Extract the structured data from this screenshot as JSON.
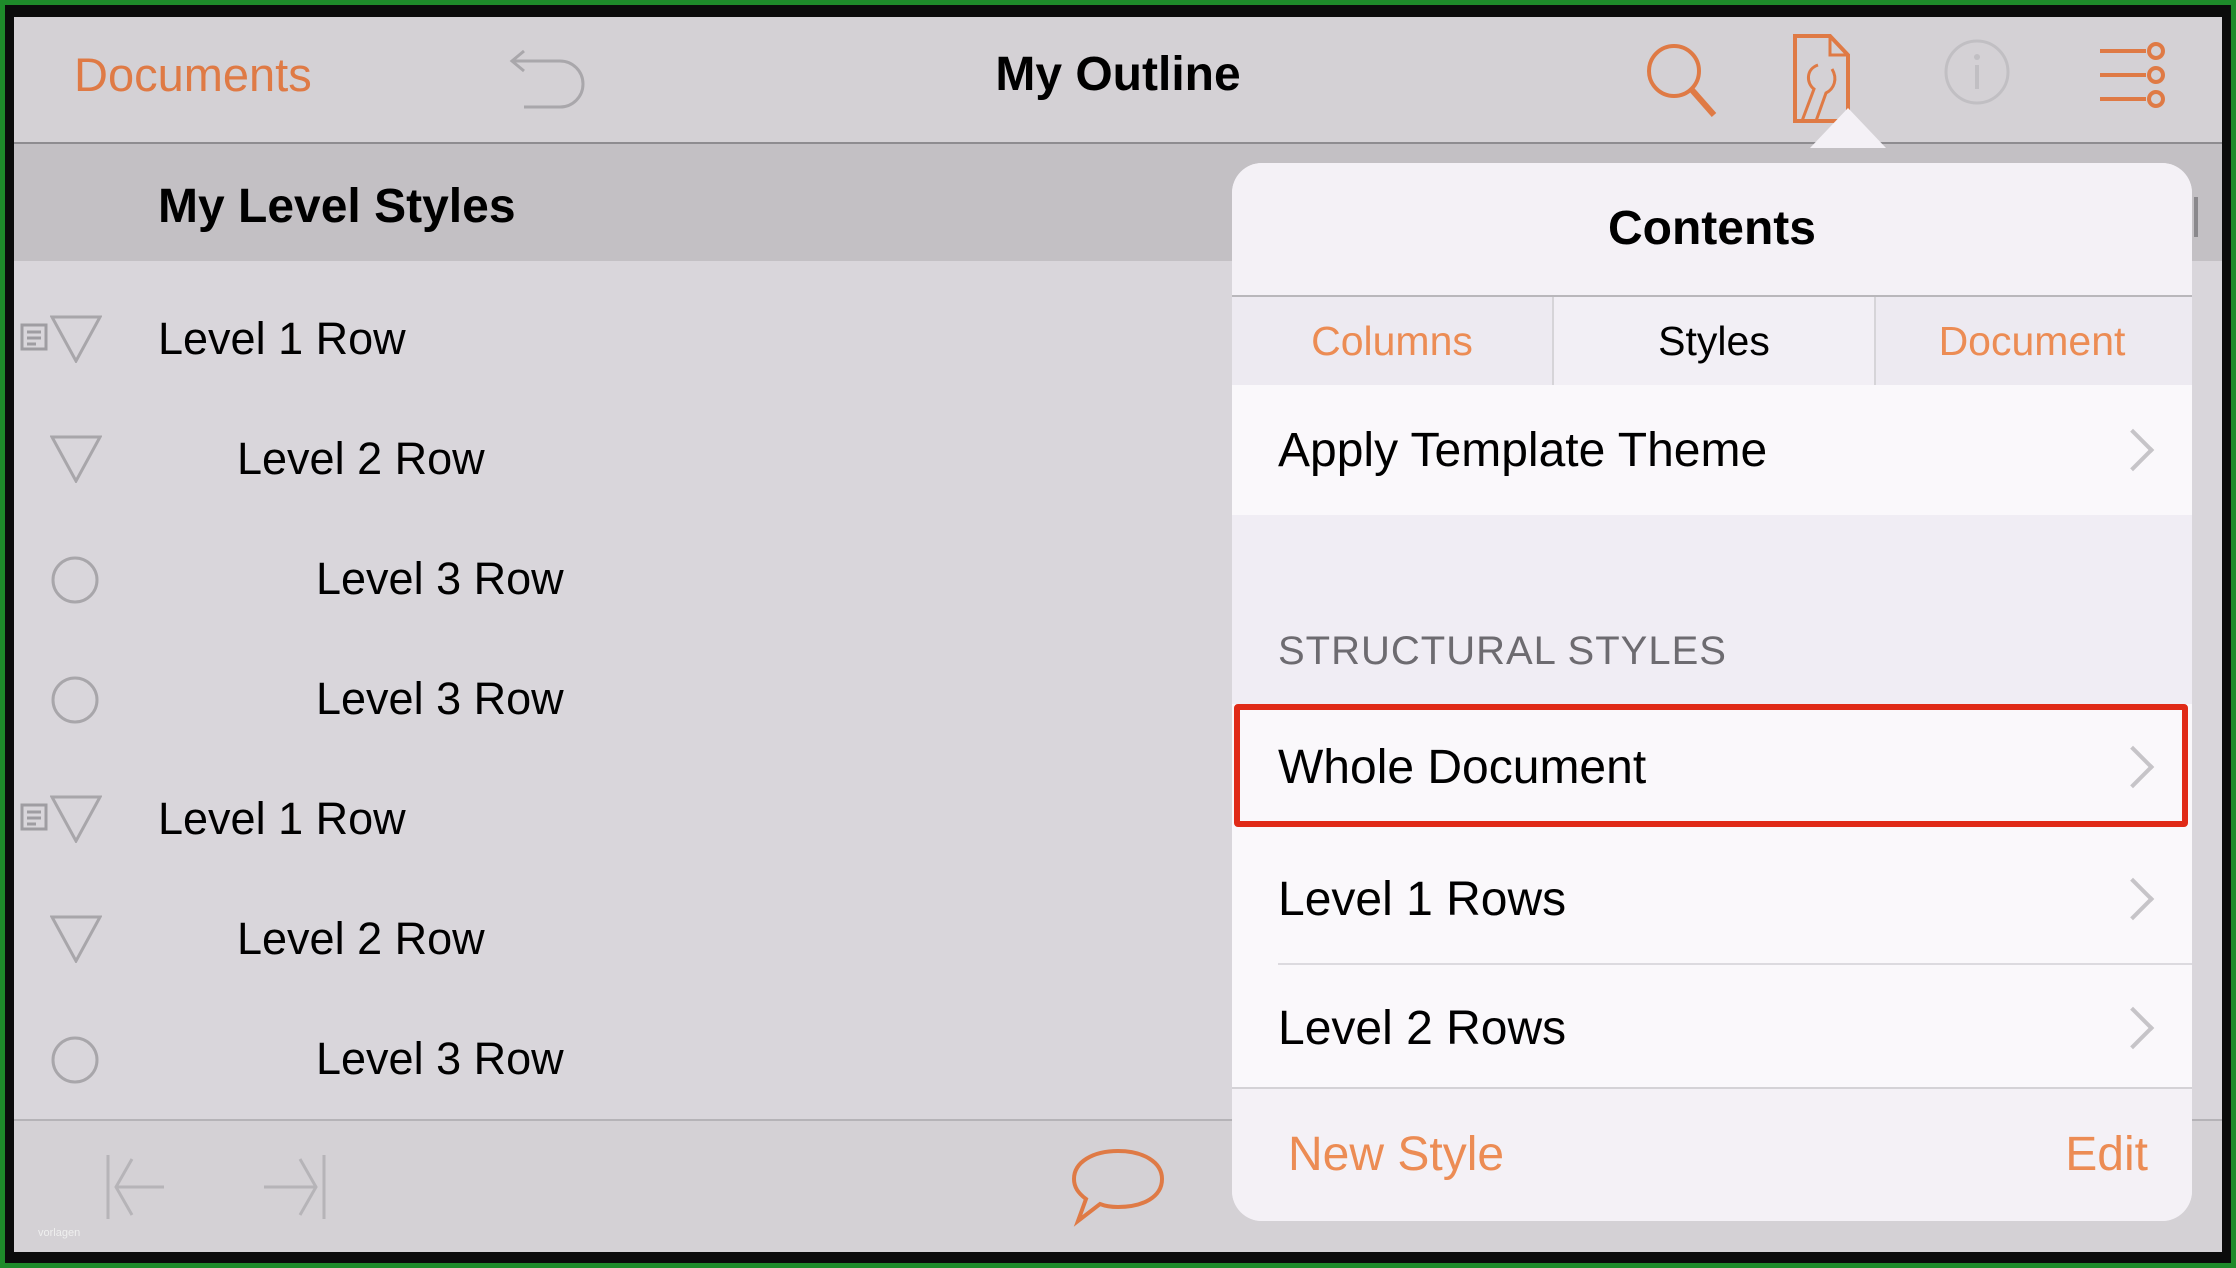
{
  "nav": {
    "back_label": "Documents",
    "title": "My Outline",
    "icons": [
      "undo-icon",
      "search-icon",
      "inspector-wrench-icon",
      "info-icon",
      "view-options-icon"
    ]
  },
  "outline": {
    "header_title": "My Level Styles",
    "rows": [
      {
        "label": "Level 1 Row",
        "level": 1,
        "handle": "triangle",
        "note": true
      },
      {
        "label": "Level 2 Row",
        "level": 2,
        "handle": "triangle",
        "note": false
      },
      {
        "label": "Level 3 Row",
        "level": 3,
        "handle": "circle",
        "note": false
      },
      {
        "label": "Level 3 Row",
        "level": 3,
        "handle": "circle",
        "note": false
      },
      {
        "label": "Level 1 Row",
        "level": 1,
        "handle": "triangle",
        "note": true
      },
      {
        "label": "Level 2 Row",
        "level": 2,
        "handle": "triangle",
        "note": false
      },
      {
        "label": "Level 3 Row",
        "level": 3,
        "handle": "circle",
        "note": false
      }
    ]
  },
  "toolbar": {
    "icons": [
      "outdent-icon",
      "indent-icon",
      "note-bubble-icon"
    ],
    "watermark": "vorlagen"
  },
  "popover": {
    "title": "Contents",
    "tabs": [
      {
        "label": "Columns",
        "selected": false
      },
      {
        "label": "Styles",
        "selected": true
      },
      {
        "label": "Document",
        "selected": false
      }
    ],
    "apply_template": "Apply Template Theme",
    "section_header": "STRUCTURAL STYLES",
    "styles": [
      {
        "label": "Whole Document",
        "highlighted": true
      },
      {
        "label": "Level 1 Rows",
        "highlighted": false
      },
      {
        "label": "Level 2 Rows",
        "highlighted": false
      }
    ],
    "footer": {
      "new_style": "New Style",
      "edit": "Edit"
    }
  },
  "colors": {
    "accent": "#df7a45",
    "highlight_border": "#e02a17",
    "frame": "#1e8a2a"
  }
}
